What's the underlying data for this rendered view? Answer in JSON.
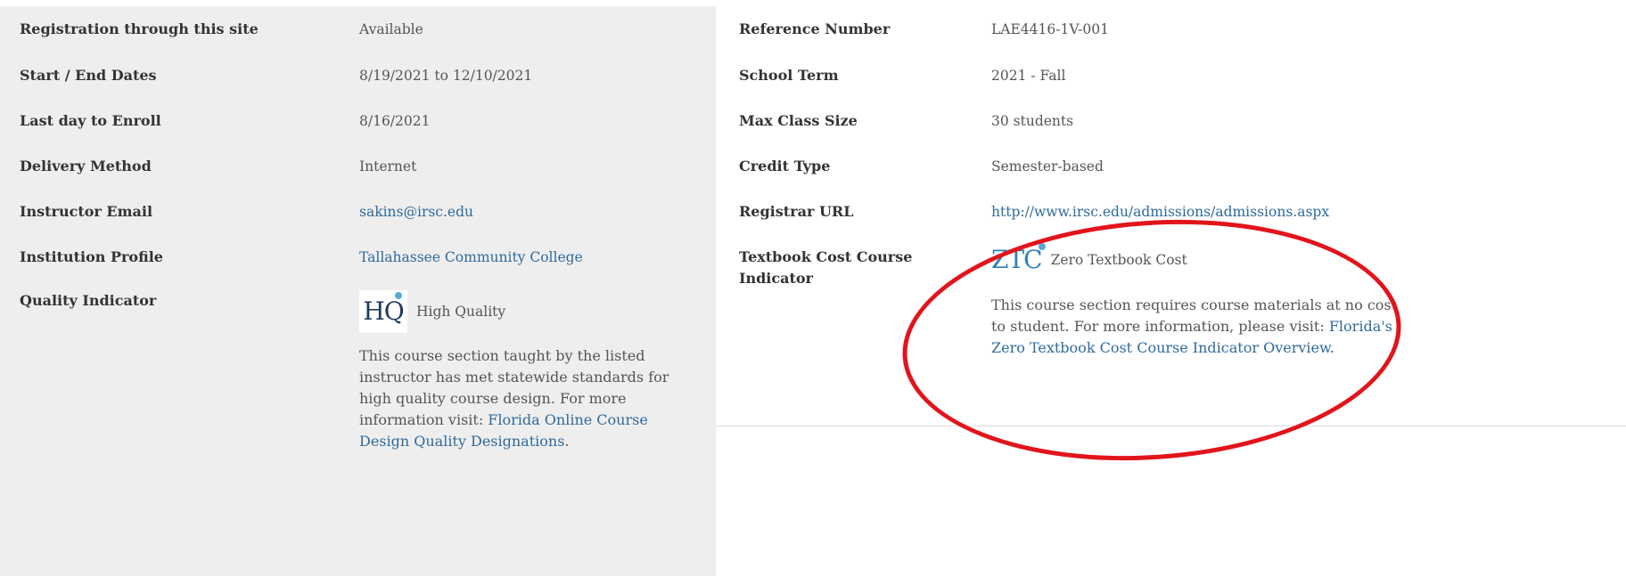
{
  "left_rows": [
    {
      "label": "Registration through this site",
      "value": "Available"
    },
    {
      "label": "Start / End Dates",
      "value": "8/19/2021 to 12/10/2021"
    },
    {
      "label": "Last day to Enroll",
      "value": "8/16/2021"
    },
    {
      "label": "Delivery Method",
      "value": "Internet"
    },
    {
      "label": "Instructor Email",
      "value": "sakins@irsc.edu"
    },
    {
      "label": "Institution Profile",
      "value": "Tallahassee Community College"
    }
  ],
  "quality": {
    "label": "Quality Indicator",
    "logo_text": "HQ",
    "badge_text": "High Quality",
    "desc_text": "This course section taught by the listed instructor has met statewide standards for high quality course design. For more information visit: ",
    "link_text": "Florida Online Course Design Quality Designations",
    "link_suffix": "."
  },
  "right_rows": [
    {
      "label": "Reference Number",
      "value": "LAE4416-1V-001"
    },
    {
      "label": "School Term",
      "value": "2021 - Fall"
    },
    {
      "label": "Max Class Size",
      "value": "30 students"
    },
    {
      "label": "Credit Type",
      "value": "Semester-based"
    },
    {
      "label": "Registrar URL",
      "value": "http://www.irsc.edu/admissions/admissions.aspx"
    }
  ],
  "textbook": {
    "label": "Textbook Cost Course Indicator",
    "logo_text": "ZTC",
    "badge_text": "Zero Textbook Cost",
    "desc_text": "This course section requires course materials at no cost to student. For more information, please visit: ",
    "link_text": "Florida's Zero Textbook Cost Course Indicator Overview",
    "link_suffix": "."
  },
  "colors": {
    "link": "#2f6a9c",
    "annotation": "#e2141b",
    "left_bg": "#eeeeee"
  }
}
